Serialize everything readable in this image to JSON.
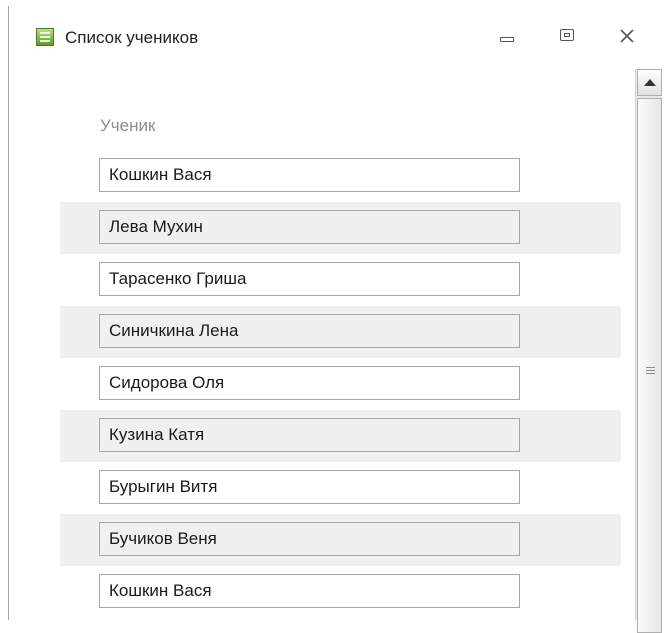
{
  "window": {
    "title": "Список учеников",
    "controls": {
      "minimize_icon": "minimize-icon",
      "maximize_icon": "restore-icon",
      "close_icon": "close-icon"
    }
  },
  "form": {
    "column_header": "Ученик",
    "rows": [
      {
        "value": "Кошкин Вася"
      },
      {
        "value": "Лева Мухин"
      },
      {
        "value": "Тарасенко Гриша"
      },
      {
        "value": "Синичкина Лена"
      },
      {
        "value": "Сидорова Оля"
      },
      {
        "value": "Кузина Катя"
      },
      {
        "value": "Бурыгин Витя"
      },
      {
        "value": "Бучиков Веня"
      },
      {
        "value": "Кошкин Вася"
      }
    ]
  },
  "colors": {
    "alt_row": "#f0f0f0",
    "field_border": "#a6a6a6",
    "header_text": "#8c8c8c"
  }
}
